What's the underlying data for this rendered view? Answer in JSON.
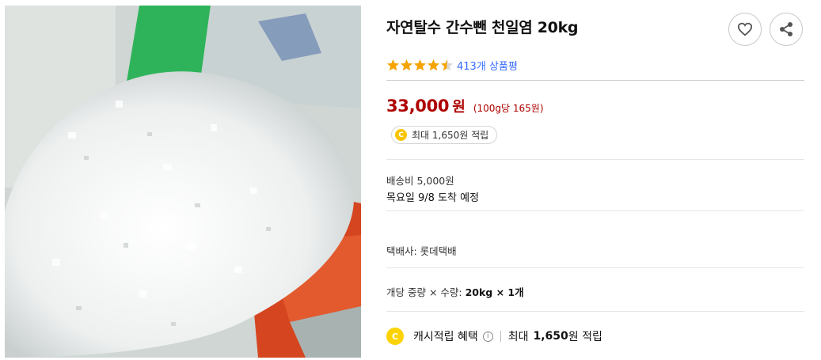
{
  "product": {
    "title": "자연탈수 간수뺀 천일염 20kg",
    "rating": 4.5,
    "review_count_label": "413개 상품평",
    "price": "33,000",
    "price_currency": "원",
    "unit_price": "(100g당 165원)",
    "reward_badge": "최대 1,650원 적립",
    "shipping_fee": "배송비 5,000원",
    "arrival": "목요일 9/8 도착 예정",
    "courier": "택배사: 롯데택배",
    "option_label": "개당 중량 × 수량:",
    "option_value": "20kg × 1개",
    "cash_label": "캐시적립 혜택",
    "cash_prefix": "최대",
    "cash_amount": "1,650",
    "cash_suffix": "원 적립",
    "coin_letter": "C",
    "info_glyph": "i"
  },
  "icons": {
    "wishlist": "heart-icon",
    "share": "share-icon"
  },
  "colors": {
    "price": "#ae0000",
    "star": "#f6a500",
    "link": "#346aff",
    "coin": "#f8c400"
  }
}
